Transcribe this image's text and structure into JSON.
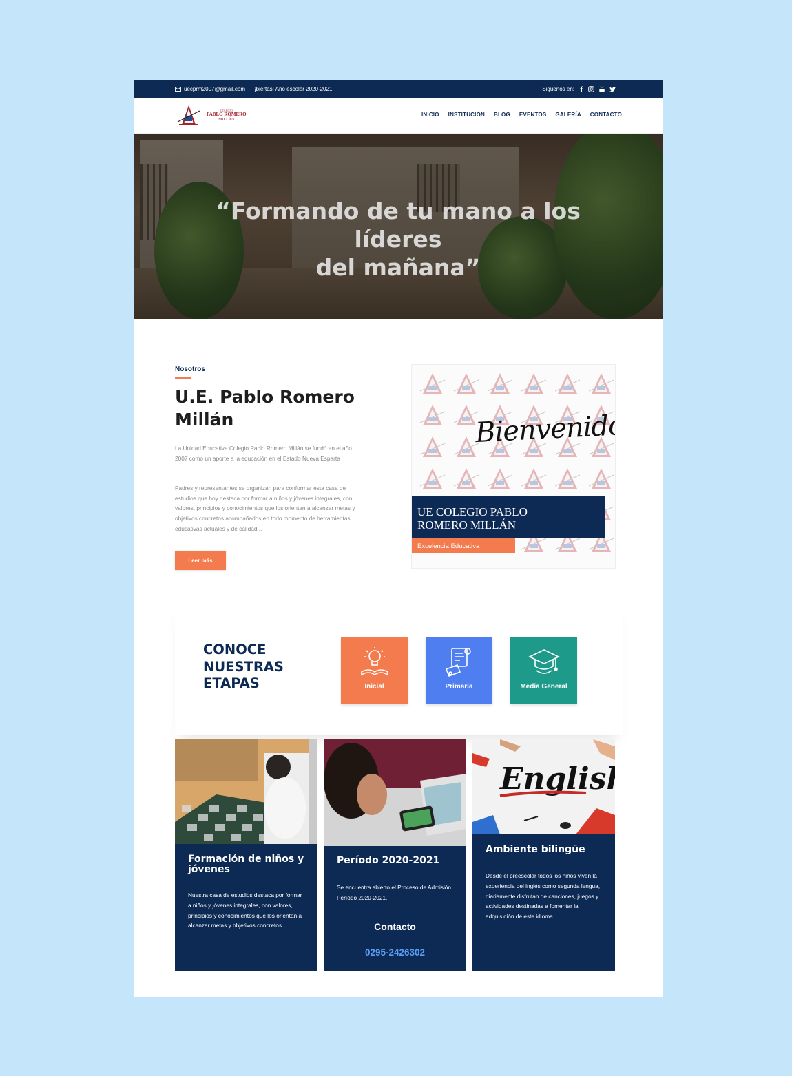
{
  "topbar": {
    "email": "uecprm2007@gmail.com",
    "announcement": "¡biertas! Año escolar 2020-2021",
    "follow_label": "Siguenos en:",
    "social_icons": [
      "facebook-icon",
      "instagram-icon",
      "youtube-icon",
      "twitter-icon"
    ]
  },
  "logo": {
    "line1": "COLEGIO",
    "line2": "PABLO ROMERO",
    "line3": "MILLÁN"
  },
  "nav": {
    "items": [
      "INICIO",
      "INSTITUCIÓN",
      "BLOG",
      "EVENTOS",
      "GALERÍA",
      "CONTACTO"
    ]
  },
  "hero": {
    "quote_line1": "“Formando de tu mano a los",
    "quote_line2": "líderes",
    "quote_line3": "del mañana”"
  },
  "about": {
    "label": "Nosotros",
    "title": "U.E. Pablo Romero Millán",
    "paragraph1": "La Unidad Educativa Colegio Pablo Romero Millán se fundó en el año 2007 como un aporte a la educación en el Estado Nueva Esparta",
    "paragraph2": "Padres y representantes se organizan para conformar esta casa de estudios que hoy destaca por formar a niños y jóvenes integrales, con valores, principios y conocimientos que los orientan a alcanzar metas y objetivos concretos acompañados en todo momento de herramientas educativas actuales y de calidad...",
    "button": "Leer más"
  },
  "welcome": {
    "script": "Bienvenidos",
    "school": "UE COLEGIO PABLO ROMERO MILLÁN",
    "tagline": "Excelencia Educativa"
  },
  "etapas": {
    "title_line1": "CONOCE",
    "title_line2": "NUESTRAS",
    "title_line3": "ETAPAS",
    "stages": [
      {
        "label": "Inicial",
        "color": "#f47b4e",
        "icon": "lightbulb-book-icon"
      },
      {
        "label": "Primaria",
        "color": "#4e7ef0",
        "icon": "diploma-icon"
      },
      {
        "label": "Media General",
        "color": "#1e9a8a",
        "icon": "graduation-cap-icon"
      }
    ]
  },
  "cards": [
    {
      "title": "Formación de niños y jóvenes",
      "text": "Nuestra casa de estudios destaca por formar a niños y jóvenes integrales, con valores, principios y conocimientos que los orientan a alcanzar metas y objetivos concretos."
    },
    {
      "title": "Período 2020-2021",
      "text": "Se encuentra abierto el Proceso de Admisión Período 2020-2021.",
      "subtitle": "Contacto",
      "phone": "0295-2426302"
    },
    {
      "title": "Ambiente bilingüe",
      "image_text": "English",
      "text": "Desde el preescolar todos los niños viven la experiencia del inglés como segunda lengua, diariamente disfrutan de canciones, juegos y actividades destinadas a fomentar la adquisición de este idioma."
    }
  ],
  "colors": {
    "navy": "#0d2a54",
    "orange": "#f47b4e",
    "blue": "#4e7ef0",
    "teal": "#1e9a8a",
    "background": "#c5e5fb"
  }
}
